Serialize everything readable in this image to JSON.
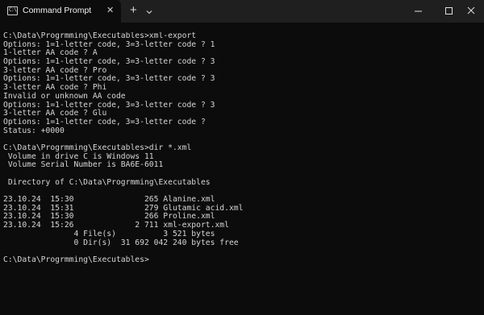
{
  "window": {
    "tab_icon_text": "C:\\",
    "tab_title": "Command Prompt",
    "tab_close": "✕",
    "new_tab": "+"
  },
  "icons": {
    "tab": "terminal-icon",
    "close_tab": "close-icon",
    "new_tab": "plus-icon",
    "dropdown": "chevron-down-icon",
    "minimize": "minimize-icon",
    "maximize": "maximize-icon",
    "close_window": "close-icon"
  },
  "colors": {
    "background": "#0c0c0c",
    "titlebar": "#1f1f1f",
    "text": "#d6d6d6"
  },
  "terminal": {
    "lines": [
      "C:\\Data\\Progrmming\\Executables>xml-export",
      "Options: 1=1-letter code, 3=3-letter code ? 1",
      "1-letter AA code ? A",
      "Options: 1=1-letter code, 3=3-letter code ? 3",
      "3-letter AA code ? Pro",
      "Options: 1=1-letter code, 3=3-letter code ? 3",
      "3-letter AA code ? Phi",
      "Invalid or unknown AA code",
      "Options: 1=1-letter code, 3=3-letter code ? 3",
      "3-letter AA code ? Glu",
      "Options: 1=1-letter code, 3=3-letter code ?",
      "Status: +0000",
      "",
      "C:\\Data\\Progrmming\\Executables>dir *.xml",
      " Volume in drive C is Windows 11",
      " Volume Serial Number is BA6E-6011",
      "",
      " Directory of C:\\Data\\Progrmming\\Executables",
      "",
      "23.10.24  15:30               265 Alanine.xml",
      "23.10.24  15:31               279 Glutamic acid.xml",
      "23.10.24  15:30               266 Proline.xml",
      "23.10.24  15:26             2 711 xml-export.xml",
      "               4 File(s)          3 521 bytes",
      "               0 Dir(s)  31 692 042 240 bytes free",
      "",
      "C:\\Data\\Progrmming\\Executables>"
    ]
  }
}
